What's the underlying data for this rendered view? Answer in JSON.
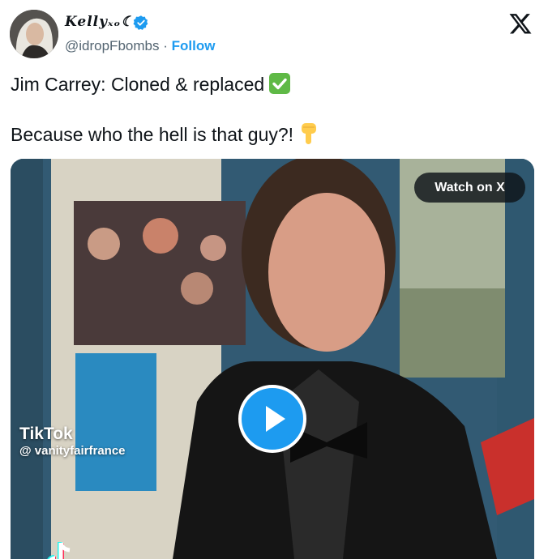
{
  "author": {
    "display_name": "Kellyₓₒ☾",
    "handle": "@idropFbombs",
    "separator": "·",
    "follow_label": "Follow",
    "verified": true
  },
  "tweet": {
    "line1": "Jim Carrey: Cloned & replaced",
    "line2": "Because who the hell is that guy?!"
  },
  "media": {
    "watch_label": "Watch on X",
    "tiktok_label": "TikTok",
    "tiktok_user": "@ vanityfairfrance"
  },
  "icons": {
    "verified": "verified-badge-icon",
    "x_logo": "x-logo-icon",
    "check_emoji": "check-mark-button-emoji",
    "pointing_emoji": "backhand-index-pointing-down-emoji",
    "play": "play-icon",
    "tiktok": "tiktok-logo-icon"
  },
  "colors": {
    "accent": "#1d9bf0",
    "text": "#0f1419",
    "muted": "#536471",
    "check_green": "#5fb946"
  }
}
